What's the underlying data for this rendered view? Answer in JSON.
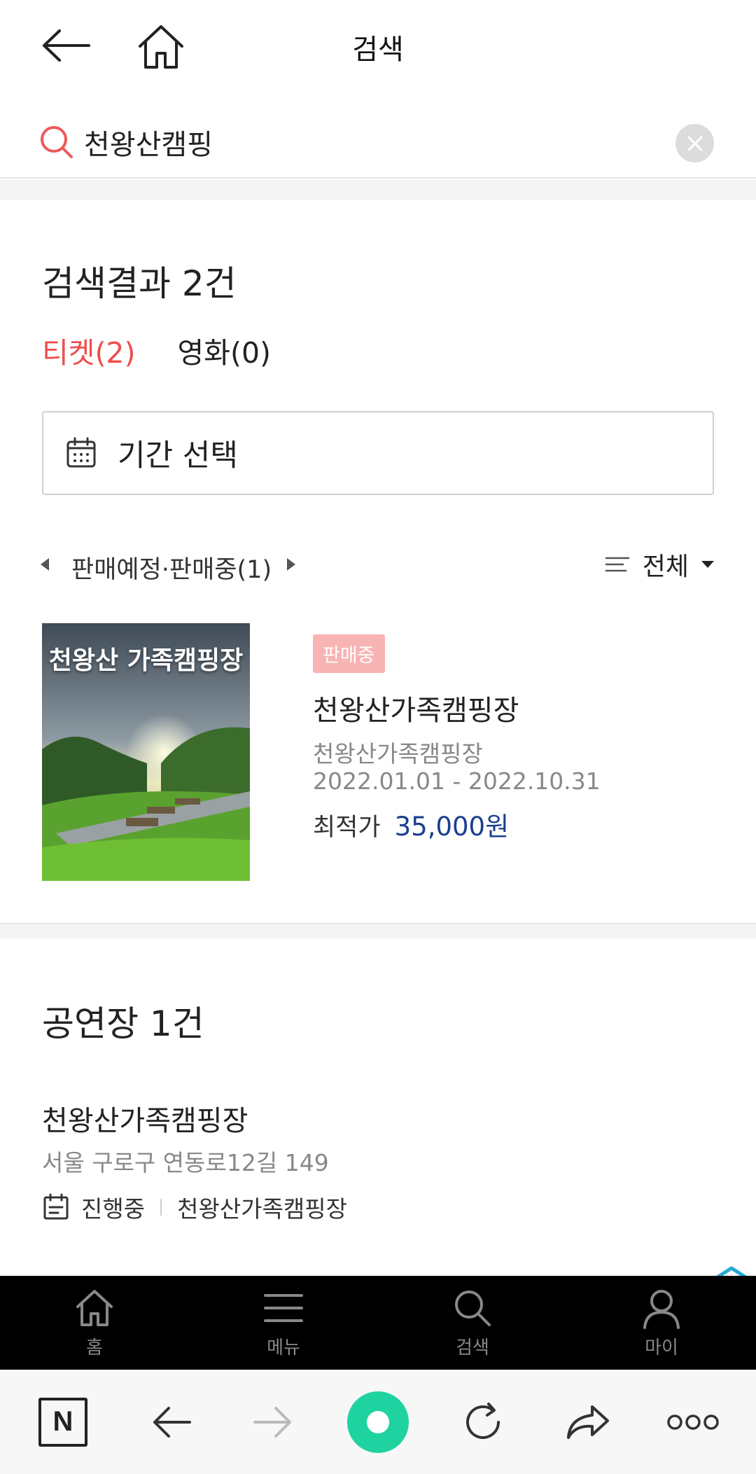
{
  "header": {
    "title": "검색"
  },
  "search": {
    "query": "천왕산캠핑",
    "placeholder": ""
  },
  "results": {
    "title": "검색결과 2건",
    "tabs": [
      {
        "label": "티켓(2)",
        "active": true
      },
      {
        "label": "영화(0)",
        "active": false
      }
    ]
  },
  "period_select": {
    "label": "기간 선택"
  },
  "filter": {
    "status_label": "판매예정·판매중(1)",
    "sort_label": "전체"
  },
  "product": {
    "poster_title": "천왕산 가족캠핑장",
    "badge": "판매중",
    "name": "천왕산가족캠핑장",
    "venue": "천왕산가족캠핑장",
    "dates": "2022.01.01 - 2022.10.31",
    "price_label": "최적가",
    "price": "35,000원"
  },
  "venues": {
    "title": "공연장 1건",
    "item": {
      "name": "천왕산가족캠핑장",
      "address": "서울 구로구 연동로12길 149",
      "status": "진행중",
      "show": "천왕산가족캠핑장"
    }
  },
  "bottom_nav": [
    {
      "label": "홈",
      "icon": "home-icon"
    },
    {
      "label": "메뉴",
      "icon": "menu-icon"
    },
    {
      "label": "검색",
      "icon": "search-icon"
    },
    {
      "label": "마이",
      "icon": "user-icon"
    }
  ],
  "browser_bar": {
    "logo_letter": "N"
  },
  "colors": {
    "accent_red": "#ee4d4d",
    "price_blue": "#1a3f8f",
    "badge_pink": "#f8b3b3",
    "browser_green": "#1fd3a0"
  }
}
